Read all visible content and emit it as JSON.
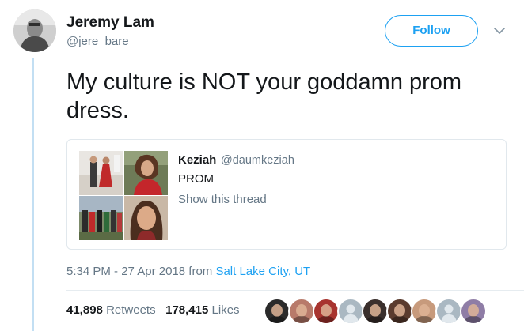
{
  "author": {
    "name": "Jeremy Lam",
    "handle": "@jere_bare",
    "avatar_icon": "person-photo-avatar"
  },
  "follow_label": "Follow",
  "menu_icon": "chevron-down-icon",
  "tweet_text": "My culture is NOT your goddamn prom dress.",
  "quoted": {
    "name": "Keziah",
    "handle": "@daumkeziah",
    "text": "PROM",
    "thread_link": "Show this thread",
    "images": [
      "group-prom-photo",
      "red-dress-portrait",
      "group-photo-outdoors",
      "selfie-portrait"
    ]
  },
  "meta": {
    "time": "5:34 PM - 27 Apr 2018",
    "from": "from",
    "location": "Salt Lake City, UT"
  },
  "stats": {
    "retweets_count": "41,898",
    "retweets_label": "Retweets",
    "likes_count": "178,415",
    "likes_label": "Likes"
  },
  "colors": {
    "accent": "#1da1f2",
    "secondary_text": "#657786",
    "thread_line": "#c3dff3"
  },
  "likers": [
    {
      "icon": "liker-avatar-1",
      "color": "#2b2b2b"
    },
    {
      "icon": "liker-avatar-2",
      "color": "#b87a6a"
    },
    {
      "icon": "liker-avatar-3",
      "color": "#a8342f"
    },
    {
      "icon": "default-egg-avatar",
      "color": "#aab8c2"
    },
    {
      "icon": "liker-avatar-5",
      "color": "#3a2f2c"
    },
    {
      "icon": "liker-avatar-6",
      "color": "#5a3b2e"
    },
    {
      "icon": "liker-avatar-7",
      "color": "#c79a7c"
    },
    {
      "icon": "default-egg-avatar",
      "color": "#aab8c2"
    },
    {
      "icon": "liker-avatar-9",
      "color": "#8f7da6"
    }
  ]
}
